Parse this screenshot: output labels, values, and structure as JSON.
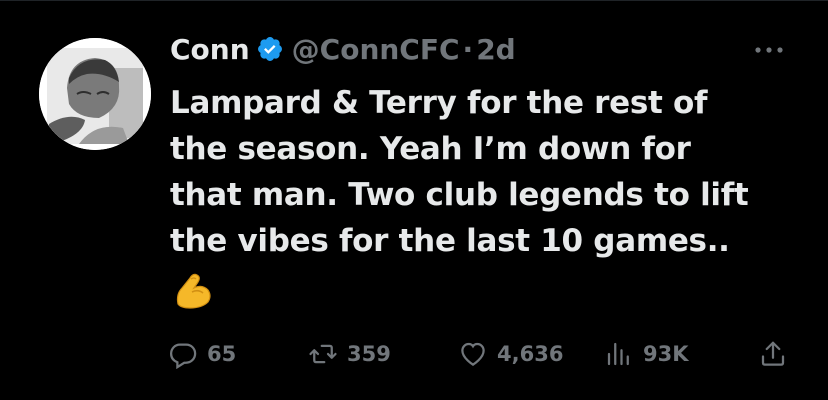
{
  "author": {
    "display_name": "Conn",
    "handle": "@ConnCFC",
    "separator": "·",
    "time_ago": "2d"
  },
  "tweet": {
    "lines": [
      "Lampard & Terry for the rest of",
      "the season. Yeah I’m down for",
      "that man. Two club legends to lift",
      "the vibes for the last 10 games.."
    ],
    "emoji": "flexed-biceps"
  },
  "actions": {
    "replies": "65",
    "retweets": "359",
    "likes": "4,636",
    "views": "93K"
  },
  "icons": {
    "verified": "verified-badge-icon",
    "more": "more-options-icon",
    "reply": "reply-icon",
    "retweet": "retweet-icon",
    "like": "heart-icon",
    "views": "views-icon",
    "share": "share-icon"
  },
  "colors": {
    "background": "#000000",
    "text": "#e7e9ea",
    "muted": "#71767b",
    "verified_blue": "#1d9bf0",
    "emoji_yellow": "#f5b829"
  }
}
